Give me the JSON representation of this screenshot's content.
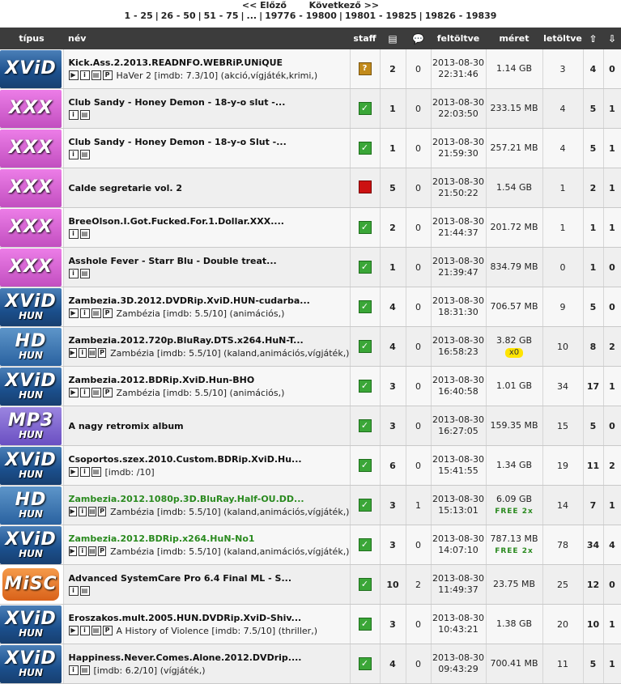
{
  "pager": {
    "prev": "<< Előző",
    "next": "Következő >>",
    "pages": [
      "1 - 25",
      "26 - 50",
      "51 - 75",
      "...",
      "19776 - 19800",
      "19801 - 19825",
      "19826 - 19839"
    ]
  },
  "columns": {
    "type": "típus",
    "name": "név",
    "staff": "staff",
    "files_icon": "files-icon",
    "comments_icon": "comments-icon",
    "uploaded": "feltöltve",
    "size": "méret",
    "downloaded": "letöltve",
    "seed_icon": "arrow-up-icon",
    "leech_icon": "arrow-down-icon"
  },
  "rows": [
    {
      "cat": "xvid",
      "cat_big": "XViD",
      "cat_small": "",
      "title": "Kick.Ass.2.2013.READNFO.WEBRiP.UNiQUE",
      "green": false,
      "icons": [
        "▶",
        "i",
        "▤",
        "P"
      ],
      "sub": "HaVer 2 [imdb: 7.3/10] (akció,vígjáték,krimi,)",
      "staff": "q",
      "files": "2",
      "comments": "0",
      "date": "2013-08-30",
      "time": "22:31:46",
      "size": "1.14 GB",
      "badge": "",
      "downloads": "3",
      "seed": "4",
      "leech": "0"
    },
    {
      "cat": "xxx",
      "cat_big": "XXX",
      "cat_small": "",
      "title": "Club Sandy - Honey Demon - 18-y-o slut -...",
      "green": false,
      "icons": [
        "i",
        "▤"
      ],
      "sub": "",
      "staff": "ok",
      "files": "1",
      "comments": "0",
      "date": "2013-08-30",
      "time": "22:03:50",
      "size": "233.15 MB",
      "badge": "",
      "downloads": "4",
      "seed": "5",
      "leech": "1"
    },
    {
      "cat": "xxx",
      "cat_big": "XXX",
      "cat_small": "",
      "title": "Club Sandy - Honey Demon - 18-y-o Slut -...",
      "green": false,
      "icons": [
        "i",
        "▤"
      ],
      "sub": "",
      "staff": "ok",
      "files": "1",
      "comments": "0",
      "date": "2013-08-30",
      "time": "21:59:30",
      "size": "257.21 MB",
      "badge": "",
      "downloads": "4",
      "seed": "5",
      "leech": "1"
    },
    {
      "cat": "xxx",
      "cat_big": "XXX",
      "cat_small": "",
      "title": "Calde segretarie vol. 2",
      "green": false,
      "icons": [],
      "sub": "",
      "staff": "x",
      "files": "5",
      "comments": "0",
      "date": "2013-08-30",
      "time": "21:50:22",
      "size": "1.54 GB",
      "badge": "",
      "downloads": "1",
      "seed": "2",
      "leech": "1"
    },
    {
      "cat": "xxx",
      "cat_big": "XXX",
      "cat_small": "",
      "title": "BreeOlson.I.Got.Fucked.For.1.Dollar.XXX....",
      "green": false,
      "icons": [
        "i",
        "▤"
      ],
      "sub": "",
      "staff": "ok",
      "files": "2",
      "comments": "0",
      "date": "2013-08-30",
      "time": "21:44:37",
      "size": "201.72 MB",
      "badge": "",
      "downloads": "1",
      "seed": "1",
      "leech": "1"
    },
    {
      "cat": "xxx",
      "cat_big": "XXX",
      "cat_small": "",
      "title": "Asshole Fever - Starr Blu - Double treat...",
      "green": false,
      "icons": [
        "i",
        "▤"
      ],
      "sub": "",
      "staff": "ok",
      "files": "1",
      "comments": "0",
      "date": "2013-08-30",
      "time": "21:39:47",
      "size": "834.79 MB",
      "badge": "",
      "downloads": "0",
      "seed": "1",
      "leech": "0"
    },
    {
      "cat": "xvid",
      "cat_big": "XViD",
      "cat_small": "HUN",
      "title": "Zambezia.3D.2012.DVDRip.XviD.HUN-cudarba...",
      "green": false,
      "icons": [
        "▶",
        "i",
        "▤",
        "P"
      ],
      "sub": "Zambézia [imdb: 5.5/10] (animációs,)",
      "staff": "ok",
      "files": "4",
      "comments": "0",
      "date": "2013-08-30",
      "time": "18:31:30",
      "size": "706.57 MB",
      "badge": "",
      "downloads": "9",
      "seed": "5",
      "leech": "0"
    },
    {
      "cat": "hd",
      "cat_big": "HD",
      "cat_small": "HUN",
      "title": "Zambezia.2012.720p.BluRay.DTS.x264.HuN-T...",
      "green": false,
      "icons": [
        "▶",
        "i",
        "▤",
        "P"
      ],
      "sub": "Zambézia [imdb: 5.5/10] (kaland,animációs,vígjáték,)",
      "staff": "ok",
      "files": "4",
      "comments": "0",
      "date": "2013-08-30",
      "time": "16:58:23",
      "size": "3.82 GB",
      "badge": "x0",
      "downloads": "10",
      "seed": "8",
      "leech": "2"
    },
    {
      "cat": "xvid",
      "cat_big": "XViD",
      "cat_small": "HUN",
      "title": "Zambezia.2012.BDRip.XviD.Hun-BHO",
      "green": false,
      "icons": [
        "▶",
        "i",
        "▤",
        "P"
      ],
      "sub": "Zambézia [imdb: 5.5/10] (animációs,)",
      "staff": "ok",
      "files": "3",
      "comments": "0",
      "date": "2013-08-30",
      "time": "16:40:58",
      "size": "1.01 GB",
      "badge": "",
      "downloads": "34",
      "seed": "17",
      "leech": "1"
    },
    {
      "cat": "mp3",
      "cat_big": "MP3",
      "cat_small": "HUN",
      "title": "A nagy retromix album",
      "green": false,
      "icons": [],
      "sub": "",
      "staff": "ok",
      "files": "3",
      "comments": "0",
      "date": "2013-08-30",
      "time": "16:27:05",
      "size": "159.35 MB",
      "badge": "",
      "downloads": "15",
      "seed": "5",
      "leech": "0"
    },
    {
      "cat": "xvid",
      "cat_big": "XViD",
      "cat_small": "HUN",
      "title": "Csoportos.szex.2010.Custom.BDRip.XviD.Hu...",
      "green": false,
      "icons": [
        "▶",
        "i",
        "▤"
      ],
      "sub": "[imdb: /10]",
      "staff": "ok",
      "files": "6",
      "comments": "0",
      "date": "2013-08-30",
      "time": "15:41:55",
      "size": "1.34 GB",
      "badge": "",
      "downloads": "19",
      "seed": "11",
      "leech": "2"
    },
    {
      "cat": "hd",
      "cat_big": "HD",
      "cat_small": "HUN",
      "title": "Zambezia.2012.1080p.3D.BluRay.Half-OU.DD...",
      "green": true,
      "icons": [
        "▶",
        "i",
        "▤",
        "P"
      ],
      "sub": "Zambézia [imdb: 5.5/10] (kaland,animációs,vígjáték,)",
      "staff": "ok",
      "files": "3",
      "comments": "1",
      "date": "2013-08-30",
      "time": "15:13:01",
      "size": "6.09 GB",
      "badge": "FREE 2x",
      "downloads": "14",
      "seed": "7",
      "leech": "1"
    },
    {
      "cat": "xvid",
      "cat_big": "XViD",
      "cat_small": "HUN",
      "title": "Zambezia.2012.BDRip.x264.HuN-No1",
      "green": true,
      "icons": [
        "▶",
        "i",
        "▤",
        "P"
      ],
      "sub": "Zambézia [imdb: 5.5/10] (kaland,animációs,vígjáték,)",
      "staff": "ok",
      "files": "3",
      "comments": "0",
      "date": "2013-08-30",
      "time": "14:07:10",
      "size": "787.13 MB",
      "badge": "FREE 2x",
      "downloads": "78",
      "seed": "34",
      "leech": "4"
    },
    {
      "cat": "misc",
      "cat_big": "MiSC",
      "cat_small": "",
      "title": "Advanced SystemCare Pro 6.4 Final ML - S...",
      "green": false,
      "icons": [
        "i",
        "▤"
      ],
      "sub": "",
      "staff": "ok",
      "files": "10",
      "comments": "2",
      "date": "2013-08-30",
      "time": "11:49:37",
      "size": "23.75 MB",
      "badge": "",
      "downloads": "25",
      "seed": "12",
      "leech": "0"
    },
    {
      "cat": "xvid",
      "cat_big": "XViD",
      "cat_small": "HUN",
      "title": "Eroszakos.mult.2005.HUN.DVDRip.XviD-Shiv...",
      "green": false,
      "icons": [
        "▶",
        "i",
        "▤",
        "P"
      ],
      "sub": "A History of Violence [imdb: 7.5/10] (thriller,)",
      "staff": "ok",
      "files": "3",
      "comments": "0",
      "date": "2013-08-30",
      "time": "10:43:21",
      "size": "1.38 GB",
      "badge": "",
      "downloads": "20",
      "seed": "10",
      "leech": "1"
    },
    {
      "cat": "xvid",
      "cat_big": "XViD",
      "cat_small": "HUN",
      "title": "Happiness.Never.Comes.Alone.2012.DVDrip....",
      "green": false,
      "icons": [
        "i",
        "▤"
      ],
      "sub": "[imdb: 6.2/10] (vígjáték,)",
      "staff": "ok",
      "files": "4",
      "comments": "0",
      "date": "2013-08-30",
      "time": "09:43:29",
      "size": "700.41 MB",
      "badge": "",
      "downloads": "11",
      "seed": "5",
      "leech": "1"
    }
  ]
}
